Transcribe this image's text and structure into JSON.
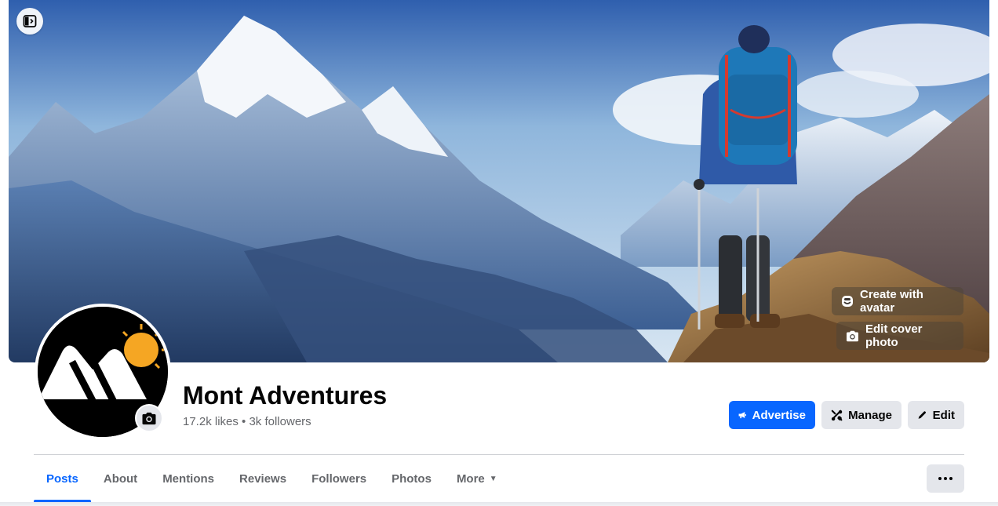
{
  "cover": {
    "create_avatar_label": "Create with avatar",
    "edit_cover_label": "Edit cover photo",
    "sidebar_toggle_icon": "sidebar-toggle-icon"
  },
  "page": {
    "name": "Mont Adventures",
    "stats": "17.2k likes • 3k followers"
  },
  "actions": {
    "advertise_label": "Advertise",
    "manage_label": "Manage",
    "edit_label": "Edit"
  },
  "tabs": [
    {
      "label": "Posts",
      "active": true
    },
    {
      "label": "About"
    },
    {
      "label": "Mentions"
    },
    {
      "label": "Reviews"
    },
    {
      "label": "Followers"
    },
    {
      "label": "Photos"
    },
    {
      "label": "More"
    }
  ],
  "colors": {
    "primary": "#0866ff",
    "secondary_bg": "#e4e6eb",
    "muted_text": "#65676b",
    "logo_sun": "#f5a623"
  }
}
